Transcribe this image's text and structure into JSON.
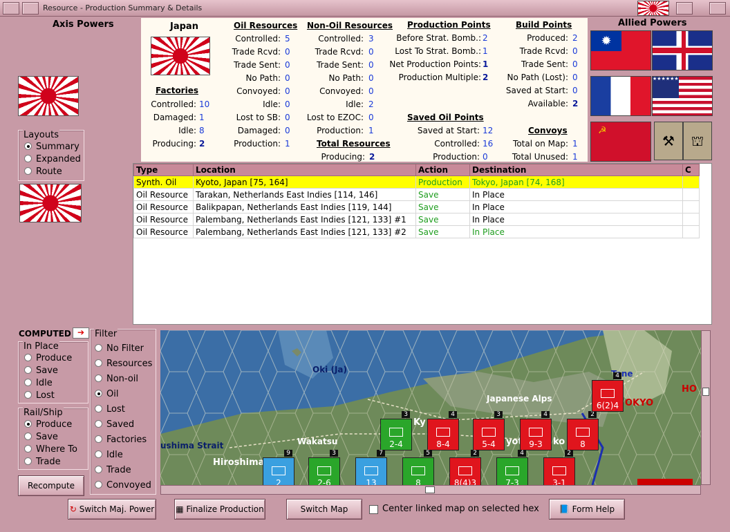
{
  "window": {
    "title": "Resource - Production Summary & Details"
  },
  "axis": {
    "heading": "Axis Powers"
  },
  "allied": {
    "heading": "Allied Powers"
  },
  "country": {
    "name": "Japan"
  },
  "layouts": {
    "legend": "Layouts",
    "options": [
      "Summary",
      "Expanded",
      "Route"
    ],
    "selected": "Summary"
  },
  "factories": {
    "title": "Factories",
    "rows": [
      {
        "label": "Controlled:",
        "value": "10"
      },
      {
        "label": "Damaged:",
        "value": "1"
      },
      {
        "label": "Idle:",
        "value": "8"
      },
      {
        "label": "Producing:",
        "value": "2"
      }
    ]
  },
  "oil": {
    "title": "Oil Resources",
    "rows": [
      {
        "label": "Controlled:",
        "value": "5"
      },
      {
        "label": "Trade Rcvd:",
        "value": "0"
      },
      {
        "label": "Trade Sent:",
        "value": "0"
      },
      {
        "label": "No Path:",
        "value": "0"
      },
      {
        "label": "Convoyed:",
        "value": "0"
      },
      {
        "label": "Idle:",
        "value": "0"
      },
      {
        "label": "Lost to SB:",
        "value": "0"
      },
      {
        "label": "Damaged:",
        "value": "0"
      },
      {
        "label": "Production:",
        "value": "1"
      }
    ]
  },
  "nonoil": {
    "title": "Non-Oil Resources",
    "rows": [
      {
        "label": "Controlled:",
        "value": "3"
      },
      {
        "label": "Trade Rcvd:",
        "value": "0"
      },
      {
        "label": "Trade Sent:",
        "value": "0"
      },
      {
        "label": "No Path:",
        "value": "0"
      },
      {
        "label": "Convoyed:",
        "value": "0"
      },
      {
        "label": "Idle:",
        "value": "2"
      },
      {
        "label": "Lost to EZOC:",
        "value": "0"
      },
      {
        "label": "Production:",
        "value": "1"
      }
    ]
  },
  "total": {
    "title": "Total Resources",
    "label": "Producing:",
    "value": "2"
  },
  "pp": {
    "title": "Production Points",
    "rows": [
      {
        "label": "Before Strat. Bomb.:",
        "value": "2"
      },
      {
        "label": "Lost To Strat. Bomb.:",
        "value": "1"
      },
      {
        "label": "Net Production Points:",
        "value": "1"
      },
      {
        "label": "Production Multiple:",
        "value": "2"
      }
    ]
  },
  "savedoil": {
    "title": "Saved Oil Points",
    "rows": [
      {
        "label": "Saved at Start:",
        "value": "12"
      },
      {
        "label": "Controlled:",
        "value": "16"
      },
      {
        "label": "Production:",
        "value": "0"
      }
    ]
  },
  "bp": {
    "title": "Build Points",
    "rows": [
      {
        "label": "Produced:",
        "value": "2"
      },
      {
        "label": "Trade Rcvd:",
        "value": "0"
      },
      {
        "label": "Trade Sent:",
        "value": "0"
      },
      {
        "label": "No Path (Lost):",
        "value": "0"
      },
      {
        "label": "Saved at Start:",
        "value": "0"
      },
      {
        "label": "Available:",
        "value": "2"
      }
    ]
  },
  "convoys": {
    "title": "Convoys",
    "rows": [
      {
        "label": "Total on Map:",
        "value": "1"
      },
      {
        "label": "Total Unused:",
        "value": "1"
      }
    ]
  },
  "table": {
    "headers": [
      "Type",
      "Location",
      "Action",
      "Destination",
      "C"
    ],
    "rows": [
      [
        "Synth. Oil",
        "Kyoto, Japan [75, 164]",
        "Production",
        "Tokyo, Japan [74, 168]",
        ""
      ],
      [
        "Oil Resource",
        "Tarakan, Netherlands East Indies [114, 146]",
        "Save",
        "In Place",
        ""
      ],
      [
        "Oil Resource",
        "Balikpapan, Netherlands East Indies [119, 144]",
        "Save",
        "In Place",
        ""
      ],
      [
        "Oil Resource",
        "Palembang, Netherlands East Indies [121, 133] #1",
        "Save",
        "In Place",
        ""
      ],
      [
        "Oil Resource",
        "Palembang, Netherlands East Indies [121, 133] #2",
        "Save",
        "In Place",
        ""
      ]
    ]
  },
  "computed": {
    "label": "COMPUTED"
  },
  "inplace": {
    "legend": "In Place",
    "options": [
      "Produce",
      "Save",
      "Idle",
      "Lost"
    ]
  },
  "railship": {
    "legend": "Rail/Ship",
    "options": [
      "Produce",
      "Save",
      "Where To",
      "Trade"
    ],
    "selected": "Produce"
  },
  "filter": {
    "legend": "Filter",
    "options": [
      "No Filter",
      "Resources",
      "Non-oil",
      "Oil",
      "Lost",
      "Saved",
      "Factories",
      "Idle",
      "Trade",
      "Convoyed"
    ],
    "selected": "Oil"
  },
  "buttons": {
    "recompute": "Recompute",
    "switch_power": "Switch Maj. Power",
    "finalize": "Finalize Production",
    "switch_map": "Switch Map",
    "form_help": "Form Help"
  },
  "center_map": {
    "label": "Center linked map on selected hex",
    "checked": false
  },
  "map": {
    "labels": [
      "Oki (Ja)",
      "Japanese Alps",
      "Wakatsu",
      "Hiroshima",
      "ushima Strait",
      "Tone",
      "OKYO",
      "HO",
      "Ky",
      "yoto",
      "ko"
    ],
    "units": [
      {
        "str": "2-4",
        "badge": "3",
        "color": "#2aa62a"
      },
      {
        "str": "8-4",
        "badge": "4",
        "color": "#e0151d"
      },
      {
        "str": "5-4",
        "badge": "3",
        "color": "#e0151d"
      },
      {
        "str": "9-3",
        "badge": "4",
        "color": "#e0151d"
      },
      {
        "str": "8",
        "badge": "2",
        "color": "#e0151d"
      },
      {
        "str": "6(2)4",
        "badge": "4",
        "color": "#e0151d"
      },
      {
        "str": "2",
        "badge": "9",
        "color": "#3aa0e0"
      },
      {
        "str": "2-6",
        "badge": "3",
        "color": "#2aa62a"
      },
      {
        "str": "13",
        "badge": "7",
        "color": "#3aa0e0"
      },
      {
        "str": "8",
        "badge": "5",
        "color": "#2aa62a"
      },
      {
        "str": "8(4)3",
        "badge": "2",
        "color": "#e0151d"
      },
      {
        "str": "7-3",
        "badge": "4",
        "color": "#2aa62a"
      },
      {
        "str": "3-1",
        "badge": "2",
        "color": "#e0151d"
      }
    ]
  },
  "colors": {
    "highlight_row": "#ffff00",
    "action_green": "#1f9d1f",
    "panel_bg": "#fffaf0"
  }
}
